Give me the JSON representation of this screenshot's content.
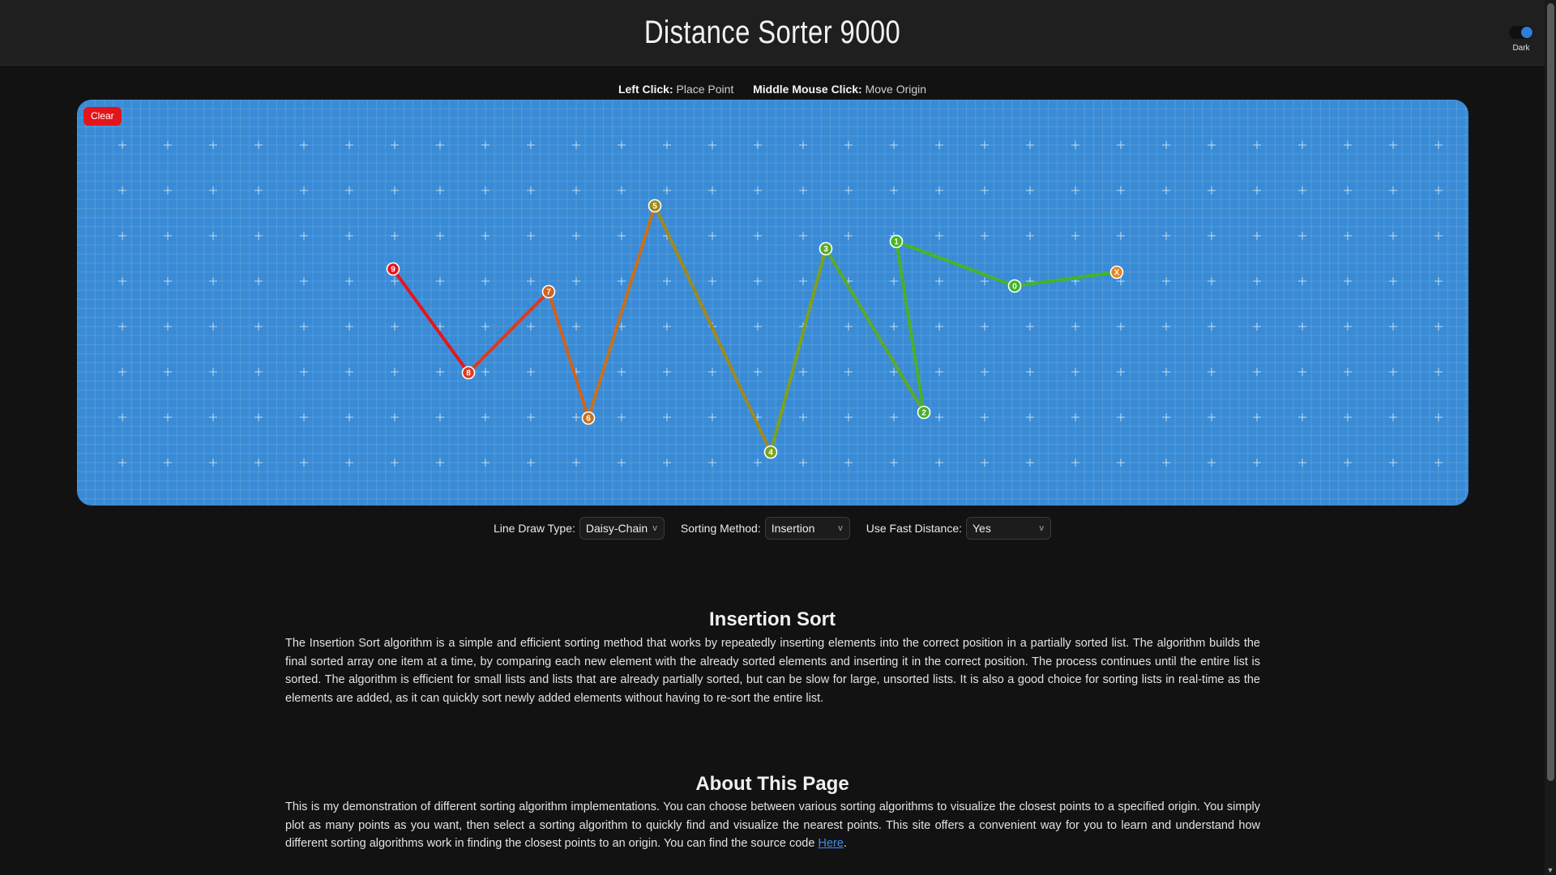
{
  "header": {
    "title": "Distance Sorter 9000",
    "theme_label": "Dark"
  },
  "instructions": {
    "left_click_key": "Left Click:",
    "left_click_action": "Place Point",
    "middle_click_key": "Middle Mouse Click:",
    "middle_click_action": "Move Origin"
  },
  "canvas": {
    "clear_label": "Clear",
    "background_color": "#3a8bd6",
    "origin_label": "X",
    "points": [
      {
        "label": "0",
        "color": "#3fb529"
      },
      {
        "label": "1",
        "color": "#45b52a"
      },
      {
        "label": "2",
        "color": "#4ab02a"
      },
      {
        "label": "3",
        "color": "#5aaa28"
      },
      {
        "label": "4",
        "color": "#7ca11f"
      },
      {
        "label": "5",
        "color": "#a08a1d"
      },
      {
        "label": "6",
        "color": "#c8701e"
      },
      {
        "label": "7",
        "color": "#d0621d"
      },
      {
        "label": "8",
        "color": "#dd3a1c"
      },
      {
        "label": "9",
        "color": "#e8141b"
      }
    ],
    "origin_color": "#e8861f"
  },
  "controls": {
    "line_draw_type_label": "Line Draw Type:",
    "line_draw_type_value": "Daisy-Chain",
    "sorting_method_label": "Sorting Method:",
    "sorting_method_value": "Insertion",
    "fast_distance_label": "Use Fast Distance:",
    "fast_distance_value": "Yes"
  },
  "insertion_sort": {
    "title": "Insertion Sort",
    "body": "The Insertion Sort algorithm is a simple and efficient sorting method that works by repeatedly inserting elements into the correct position in a partially sorted list. The algorithm builds the final sorted array one item at a time, by comparing each new element with the already sorted elements and inserting it in the correct position. The process continues until the entire list is sorted. The algorithm is efficient for small lists and lists that are already partially sorted, but can be slow for large, unsorted lists. It is also a good choice for sorting lists in real-time as the elements are added, as it can quickly sort newly added elements without having to re-sort the entire list."
  },
  "about": {
    "title": "About This Page",
    "body": "This is my demonstration of different sorting algorithm implementations. You can choose between various sorting algorithms to visualize the closest points to a specified origin. You simply plot as many points as you want, then select a sorting algorithm to quickly find and visualize the nearest points. This site offers a convenient way for you to learn and understand how different sorting algorithms work in finding the closest points to an origin. You can find the source code ",
    "link_text": "Here",
    "body_end": "."
  }
}
